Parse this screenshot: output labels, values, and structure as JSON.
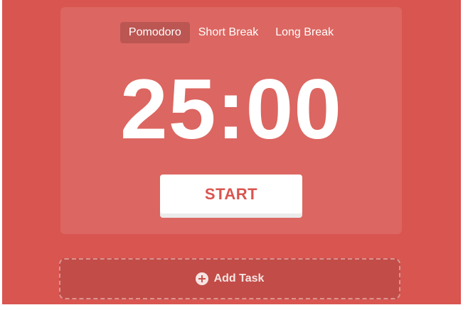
{
  "tabs": [
    {
      "label": "Pomodoro",
      "active": true
    },
    {
      "label": "Short Break",
      "active": false
    },
    {
      "label": "Long Break",
      "active": false
    }
  ],
  "timer": {
    "display": "25:00"
  },
  "start_button": {
    "label": "START"
  },
  "add_task": {
    "label": "Add Task",
    "icon": "plus-circle-icon"
  },
  "colors": {
    "background": "#d95550",
    "accent": "#d95550",
    "text": "#ffffff"
  }
}
